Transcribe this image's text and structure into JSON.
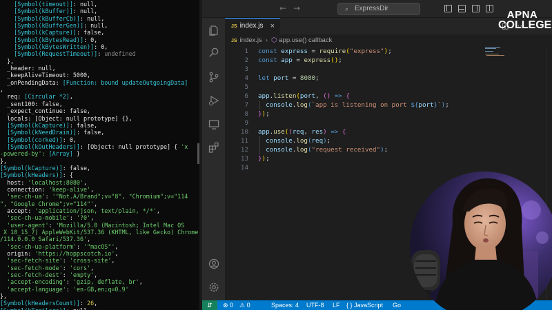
{
  "terminal": {
    "lines": [
      [
        [
          "    [Symbol(timeout)]",
          "cyan"
        ],
        [
          ": null,",
          "white"
        ]
      ],
      [
        [
          "    [Symbol(kBuffer)]",
          "cyan"
        ],
        [
          ": null,",
          "white"
        ]
      ],
      [
        [
          "    [Symbol(kBufferCb)]",
          "cyan"
        ],
        [
          ": null,",
          "white"
        ]
      ],
      [
        [
          "    [Symbol(kBufferGen)]",
          "cyan"
        ],
        [
          ": null,",
          "white"
        ]
      ],
      [
        [
          "    [Symbol(kCapture)]",
          "cyan"
        ],
        [
          ": false,",
          "white"
        ]
      ],
      [
        [
          "    [Symbol(kBytesRead)]",
          "cyan"
        ],
        [
          ": 0,",
          "white"
        ]
      ],
      [
        [
          "    [Symbol(kBytesWritten)]",
          "cyan"
        ],
        [
          ": 0,",
          "white"
        ]
      ],
      [
        [
          "    [Symbol(RequestTimeout)]",
          "cyan"
        ],
        [
          ": ",
          "white"
        ],
        [
          "undefined",
          "grey"
        ]
      ],
      [
        [
          "  },",
          "white"
        ]
      ],
      [
        [
          "  _header: null,",
          "white"
        ]
      ],
      [
        [
          "  _keepAliveTimeout: 5000,",
          "white"
        ]
      ],
      [
        [
          "  _onPendingData: ",
          "white"
        ],
        [
          "[Function: bound updateOutgoingData]",
          "cyan"
        ]
      ],
      [
        [
          ",",
          "white"
        ]
      ],
      [
        [
          "  req: ",
          "white"
        ],
        [
          "[Circular *2]",
          "cyan"
        ],
        [
          ",",
          "white"
        ]
      ],
      [
        [
          "  _sent100: false,",
          "white"
        ]
      ],
      [
        [
          "  _expect_continue: false,",
          "white"
        ]
      ],
      [
        [
          "  locals: [Object: null prototype] {},",
          "white"
        ]
      ],
      [
        [
          "  [Symbol(kCapture)]",
          "cyan"
        ],
        [
          ": false,",
          "white"
        ]
      ],
      [
        [
          "  [Symbol(kNeedDrain)]",
          "cyan"
        ],
        [
          ": false,",
          "white"
        ]
      ],
      [
        [
          "  [Symbol(corked)]",
          "cyan"
        ],
        [
          ": 0,",
          "white"
        ]
      ],
      [
        [
          "  [Symbol(kOutHeaders)]",
          "cyan"
        ],
        [
          ": [Object: null prototype] { ",
          "white"
        ],
        [
          "'x",
          "green"
        ]
      ],
      [
        [
          "-powered-by': ",
          "green"
        ],
        [
          "[Array]",
          "cyan"
        ],
        [
          " }",
          "white"
        ]
      ],
      [
        [
          "},",
          "white"
        ]
      ],
      [
        [
          "[Symbol(kCapture)]",
          "cyan"
        ],
        [
          ": false,",
          "white"
        ]
      ],
      [
        [
          "[Symbol(kHeaders)]",
          "cyan"
        ],
        [
          ": {",
          "white"
        ]
      ],
      [
        [
          "  host: ",
          "white"
        ],
        [
          "'localhost:8080'",
          "green"
        ],
        [
          ",",
          "white"
        ]
      ],
      [
        [
          "  connection: ",
          "white"
        ],
        [
          "'keep-alive'",
          "green"
        ],
        [
          ",",
          "white"
        ]
      ],
      [
        [
          "  'sec-ch-ua'",
          "green"
        ],
        [
          ": ",
          "white"
        ],
        [
          "'\"Not.A/Brand\";v=\"8\", \"Chromium\";v=\"114",
          "green"
        ]
      ],
      [
        [
          "\", \"Google Chrome\";v=\"114\"'",
          "green"
        ],
        [
          ",",
          "white"
        ]
      ],
      [
        [
          "  accept: ",
          "white"
        ],
        [
          "'application/json, text/plain, */*'",
          "green"
        ],
        [
          ",",
          "white"
        ]
      ],
      [
        [
          "  'sec-ch-ua-mobile'",
          "green"
        ],
        [
          ": ",
          "white"
        ],
        [
          "'?0'",
          "green"
        ],
        [
          ",",
          "white"
        ]
      ],
      [
        [
          "  'user-agent'",
          "green"
        ],
        [
          ": ",
          "white"
        ],
        [
          "'Mozilla/5.0 (Macintosh; Intel Mac OS",
          "green"
        ]
      ],
      [
        [
          " X 10_15_7) AppleWebKit/537.36 (KHTML, like Gecko) Chrome",
          "green"
        ]
      ],
      [
        [
          "/114.0.0.0 Safari/537.36'",
          "green"
        ],
        [
          ",",
          "white"
        ]
      ],
      [
        [
          "  'sec-ch-ua-platform'",
          "green"
        ],
        [
          ": ",
          "white"
        ],
        [
          "'\"macOS\"'",
          "green"
        ],
        [
          ",",
          "white"
        ]
      ],
      [
        [
          "  origin: ",
          "white"
        ],
        [
          "'https://hoppscotch.io'",
          "green"
        ],
        [
          ",",
          "white"
        ]
      ],
      [
        [
          "  'sec-fetch-site'",
          "green"
        ],
        [
          ": ",
          "white"
        ],
        [
          "'cross-site'",
          "green"
        ],
        [
          ",",
          "white"
        ]
      ],
      [
        [
          "  'sec-fetch-mode'",
          "green"
        ],
        [
          ": ",
          "white"
        ],
        [
          "'cors'",
          "green"
        ],
        [
          ",",
          "white"
        ]
      ],
      [
        [
          "  'sec-fetch-dest'",
          "green"
        ],
        [
          ": ",
          "white"
        ],
        [
          "'empty'",
          "green"
        ],
        [
          ",",
          "white"
        ]
      ],
      [
        [
          "  'accept-encoding'",
          "green"
        ],
        [
          ": ",
          "white"
        ],
        [
          "'gzip, deflate, br'",
          "green"
        ],
        [
          ",",
          "white"
        ]
      ],
      [
        [
          "  'accept-language'",
          "green"
        ],
        [
          ": ",
          "white"
        ],
        [
          "'en-GB,en;q=0.9'",
          "green"
        ]
      ],
      [
        [
          "},",
          "white"
        ]
      ],
      [
        [
          "[Symbol(kHeadersCount)]",
          "cyan"
        ],
        [
          ": ",
          "white"
        ],
        [
          "26",
          "yellow"
        ],
        [
          ",",
          "white"
        ]
      ],
      [
        [
          "[Symbol(kTrailers)]",
          "cyan"
        ],
        [
          ": null,",
          "white"
        ]
      ]
    ]
  },
  "titlebar": {
    "search_label": "ExpressDir"
  },
  "tab": {
    "badge": "JS",
    "label": "index.js",
    "close": "×"
  },
  "breadcrumb": {
    "badge": "JS",
    "file": "index.js",
    "separator": "›",
    "symbol": "app.use() callback"
  },
  "editor": {
    "line_numbers": [
      "1",
      "2",
      "3",
      "4",
      "5",
      "6",
      "7",
      "8",
      "9",
      "10",
      "11",
      "12",
      "13",
      "14"
    ],
    "lines": [
      [
        [
          "const",
          "k"
        ],
        [
          " ",
          "p"
        ],
        [
          "express",
          "v"
        ],
        [
          " = ",
          "p"
        ],
        [
          "require",
          "f"
        ],
        [
          "(",
          "y"
        ],
        [
          "\"express\"",
          "s"
        ],
        [
          ")",
          "y"
        ],
        [
          ";",
          "p"
        ]
      ],
      [
        [
          "const",
          "k"
        ],
        [
          " ",
          "p"
        ],
        [
          "app",
          "v"
        ],
        [
          " = ",
          "p"
        ],
        [
          "express",
          "f"
        ],
        [
          "()",
          "y"
        ],
        [
          ";",
          "p"
        ]
      ],
      [],
      [
        [
          "let",
          "k"
        ],
        [
          " ",
          "p"
        ],
        [
          "port",
          "v"
        ],
        [
          " = ",
          "p"
        ],
        [
          "8080",
          "n"
        ],
        [
          ";",
          "p"
        ]
      ],
      [],
      [
        [
          "app",
          "v"
        ],
        [
          ".",
          "p"
        ],
        [
          "listen",
          "f"
        ],
        [
          "(",
          "y"
        ],
        [
          "port",
          "v"
        ],
        [
          ", ",
          "p"
        ],
        [
          "()",
          "pu"
        ],
        [
          " => ",
          "k"
        ],
        [
          "{",
          "pu"
        ]
      ],
      [
        [
          "  console",
          "v"
        ],
        [
          ".",
          "p"
        ],
        [
          "log",
          "f"
        ],
        [
          "(",
          "k"
        ],
        [
          "`app is listening on port ",
          "s"
        ],
        [
          "${",
          "k"
        ],
        [
          "port",
          "v"
        ],
        [
          "}",
          "k"
        ],
        [
          "`",
          "s"
        ],
        [
          ")",
          "k"
        ],
        [
          ";",
          "p"
        ]
      ],
      [
        [
          "}",
          "pu"
        ],
        [
          ")",
          "y"
        ],
        [
          ";",
          "p"
        ]
      ],
      [],
      [
        [
          "app",
          "v"
        ],
        [
          ".",
          "p"
        ],
        [
          "use",
          "f"
        ],
        [
          "(",
          "y"
        ],
        [
          "(",
          "pu"
        ],
        [
          "req",
          "v"
        ],
        [
          ", ",
          "p"
        ],
        [
          "res",
          "v"
        ],
        [
          ")",
          "pu"
        ],
        [
          " => ",
          "k"
        ],
        [
          "{",
          "pu"
        ]
      ],
      [
        [
          "  console",
          "v"
        ],
        [
          ".",
          "p"
        ],
        [
          "log",
          "f"
        ],
        [
          "(",
          "k"
        ],
        [
          "req",
          "v"
        ],
        [
          ")",
          "k"
        ],
        [
          ";",
          "p"
        ]
      ],
      [
        [
          "  console",
          "v"
        ],
        [
          ".",
          "p"
        ],
        [
          "log",
          "f"
        ],
        [
          "(",
          "k"
        ],
        [
          "\"request received\"",
          "s"
        ],
        [
          ")",
          "k"
        ],
        [
          ";",
          "p"
        ]
      ],
      [
        [
          "}",
          "pu"
        ],
        [
          ")",
          "y"
        ],
        [
          ";",
          "p"
        ]
      ],
      []
    ]
  },
  "statusbar": {
    "remote": "⇵",
    "errors": "⊗ 0",
    "warnings": "⚠ 0",
    "spaces": "Spaces: 4",
    "encoding": "UTF-8",
    "eol": "LF",
    "language": "{ } JavaScript",
    "golive": "Go"
  },
  "logo": {
    "line1": "APNA",
    "line2": "COLLEGE"
  },
  "colors": {
    "accent": "#007acc",
    "terminal_bg": "#0b0b0b",
    "editor_bg": "#1e1e1e"
  }
}
